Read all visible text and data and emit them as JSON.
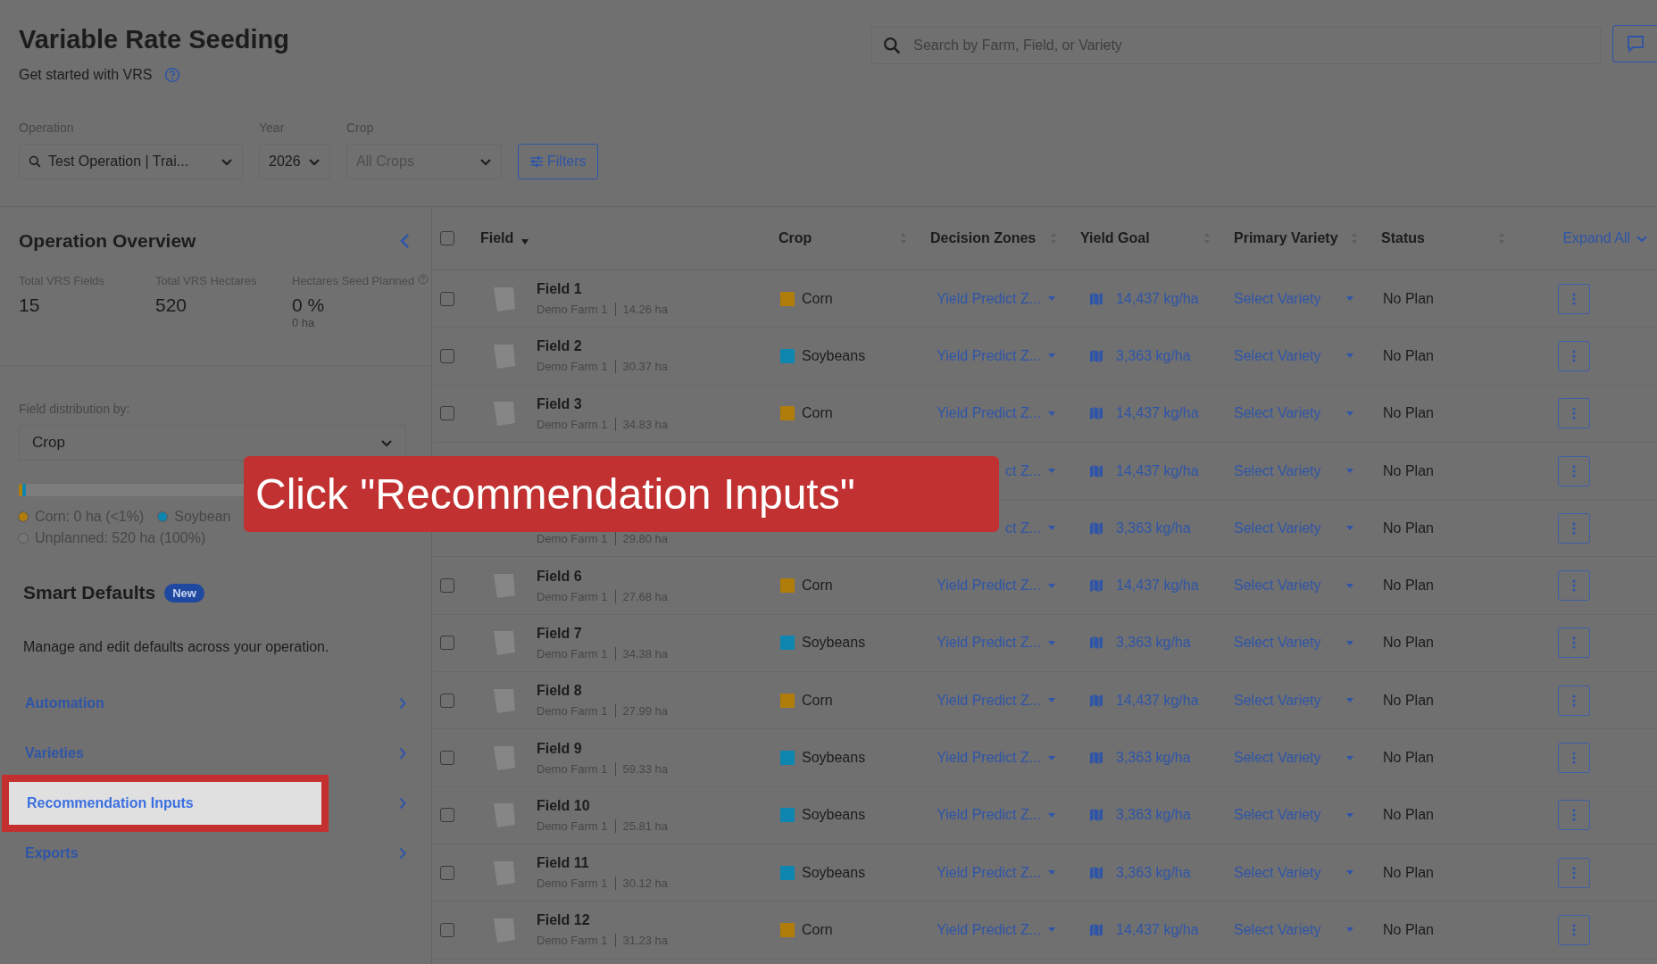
{
  "header": {
    "title": "Variable Rate Seeding",
    "subtitle": "Get started with VRS",
    "search": {
      "placeholder": "Search by Farm, Field, or Variety"
    }
  },
  "filters": [
    {
      "label": "Operation",
      "value": "Test Operation | Trai...",
      "kind": "search-select"
    },
    {
      "label": "Year",
      "value": "2026",
      "kind": "select"
    },
    {
      "label": "Crop",
      "placeholder": "All Crops",
      "kind": "select"
    }
  ],
  "filters_button": "Filters",
  "overview": {
    "title": "Operation Overview",
    "stats": [
      {
        "label": "Total VRS Fields",
        "value": "15",
        "help": false
      },
      {
        "label": "Total VRS Hectares",
        "value": "520",
        "help": false
      },
      {
        "label": "Hectares Seed Planned",
        "value": "0 %",
        "sub": "0 ha",
        "help": true
      }
    ]
  },
  "distribution": {
    "label": "Field distribution by:",
    "value": "Crop",
    "bar": [
      {
        "color": "#b07c0a",
        "level": 0.006
      },
      {
        "color": "#0f86b0",
        "level": 0.006
      }
    ],
    "legend": [
      {
        "label": "Corn: 0 ha (<1%)",
        "color": "#b07c0a"
      },
      {
        "label": "Soybean",
        "color": "#0f86b0"
      },
      {
        "label": "Unplanned: 520 ha (100%)",
        "color": "#767676"
      }
    ]
  },
  "smart_defaults": {
    "title": "Smart Defaults",
    "badge": "New",
    "description": "Manage and edit defaults across your operation.",
    "links": [
      {
        "label": "Automation",
        "selected": false
      },
      {
        "label": "Varieties",
        "selected": false
      },
      {
        "label": "Recommendation Inputs",
        "selected": true
      },
      {
        "label": "Exports",
        "selected": false
      }
    ]
  },
  "table": {
    "columns": [
      {
        "label": "Field",
        "sorted": true
      },
      {
        "label": "Crop",
        "sorted": false
      },
      {
        "label": "Decision Zones",
        "sorted": false
      },
      {
        "label": "Yield Goal",
        "sorted": false
      },
      {
        "label": "Primary Variety",
        "sorted": false
      },
      {
        "label": "Status",
        "sorted": false
      }
    ],
    "select_all": {
      "checked": false
    },
    "expand_all": "Expand All",
    "rows": [
      {
        "checked": false,
        "name": "Field 1",
        "farm": "Demo Farm 1",
        "area": "14.26 ha",
        "crop": "Corn",
        "color": "#b07c0a",
        "zone": "Yield Predict Z...",
        "yield": "14,437 kg/ha",
        "variety": "Select Variety",
        "status": "No Plan"
      },
      {
        "checked": false,
        "name": "Field 2",
        "farm": "Demo Farm 1",
        "area": "30.37 ha",
        "crop": "Soybeans",
        "color": "#0f86b0",
        "zone": "Yield Predict Z...",
        "yield": "3,363 kg/ha",
        "variety": "Select Variety",
        "status": "No Plan"
      },
      {
        "checked": false,
        "name": "Field 3",
        "farm": "Demo Farm 1",
        "area": "34.83 ha",
        "crop": "Corn",
        "color": "#b07c0a",
        "zone": "Yield Predict Z...",
        "yield": "14,437 kg/ha",
        "variety": "Select Variety",
        "status": "No Plan"
      },
      {
        "zone": "ct Z...",
        "yield": "14,437 kg/ha",
        "variety": "Select Variety",
        "status": "No Plan"
      },
      {
        "farm": "Demo Farm 1",
        "area": "29.80 ha",
        "zone": "ct Z...",
        "yield": "3,363 kg/ha",
        "variety": "Select Variety",
        "status": "No Plan"
      },
      {
        "checked": false,
        "name": "Field 6",
        "farm": "Demo Farm 1",
        "area": "27.68 ha",
        "crop": "Corn",
        "color": "#b07c0a",
        "zone": "Yield Predict Z...",
        "yield": "14,437 kg/ha",
        "variety": "Select Variety",
        "status": "No Plan"
      },
      {
        "checked": false,
        "name": "Field 7",
        "farm": "Demo Farm 1",
        "area": "34.38 ha",
        "crop": "Soybeans",
        "color": "#0f86b0",
        "zone": "Yield Predict Z...",
        "yield": "3,363 kg/ha",
        "variety": "Select Variety",
        "status": "No Plan"
      },
      {
        "checked": false,
        "name": "Field 8",
        "farm": "Demo Farm 1",
        "area": "27.99 ha",
        "crop": "Corn",
        "color": "#b07c0a",
        "zone": "Yield Predict Z...",
        "yield": "14,437 kg/ha",
        "variety": "Select Variety",
        "status": "No Plan"
      },
      {
        "checked": false,
        "name": "Field 9",
        "farm": "Demo Farm 1",
        "area": "59.33 ha",
        "crop": "Soybeans",
        "color": "#0f86b0",
        "zone": "Yield Predict Z...",
        "yield": "3,363 kg/ha",
        "variety": "Select Variety",
        "status": "No Plan"
      },
      {
        "checked": false,
        "name": "Field 10",
        "farm": "Demo Farm 1",
        "area": "25.81 ha",
        "crop": "Soybeans",
        "color": "#0f86b0",
        "zone": "Yield Predict Z...",
        "yield": "3,363 kg/ha",
        "variety": "Select Variety",
        "status": "No Plan"
      },
      {
        "checked": false,
        "name": "Field 11",
        "farm": "Demo Farm 1",
        "area": "30.12 ha",
        "crop": "Soybeans",
        "color": "#0f86b0",
        "zone": "Yield Predict Z...",
        "yield": "3,363 kg/ha",
        "variety": "Select Variety",
        "status": "No Plan"
      },
      {
        "checked": false,
        "name": "Field 12",
        "farm": "Demo Farm 1",
        "area": "31.23 ha",
        "crop": "Corn",
        "color": "#b07c0a",
        "zone": "Yield Predict Z...",
        "yield": "14,437 kg/ha",
        "variety": "Select Variety",
        "status": "No Plan"
      }
    ]
  },
  "callout": {
    "text": "Click \"Recommendation Inputs\""
  }
}
